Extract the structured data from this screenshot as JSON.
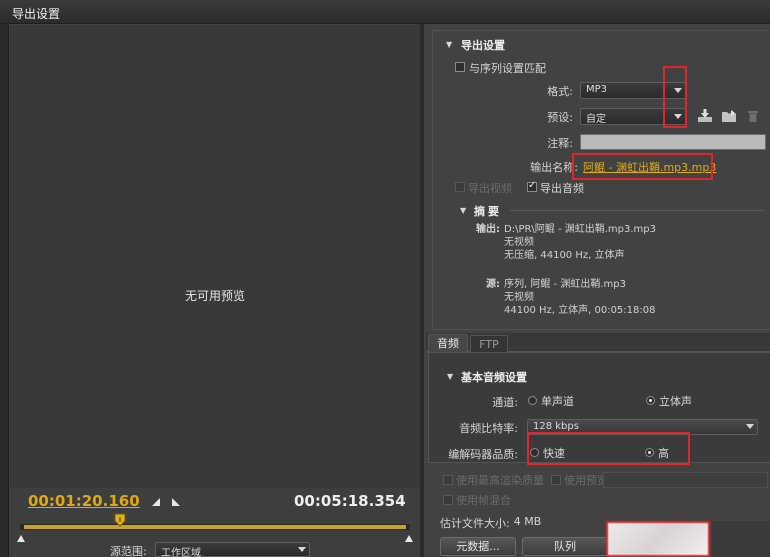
{
  "window": {
    "title": "导出设置"
  },
  "preview": {
    "no_preview_text": "无可用预览",
    "current_timecode": "00:01:20.160",
    "duration_timecode": "00:05:18.354",
    "source_range_label": "源范围:",
    "source_range_value": "工作区域"
  },
  "export_settings": {
    "section_title": "导出设置",
    "match_sequence_label": "与序列设置匹配",
    "match_sequence_checked": false,
    "format_label": "格式:",
    "format_value": "MP3",
    "preset_label": "预设:",
    "preset_value": "自定",
    "comments_label": "注释:",
    "output_name_label": "输出名称:",
    "output_name_value": "阿鲲 - 渊虹出鞘.mp3.mp3",
    "export_video_label": "导出视频",
    "export_video_checked": false,
    "export_audio_label": "导出音频",
    "export_audio_checked": true
  },
  "summary": {
    "section_title": "摘要",
    "output_label": "输出:",
    "output_lines": [
      "D:\\PR\\阿鲲 - 渊虹出鞘.mp3.mp3",
      "无视频",
      "无压缩, 44100 Hz, 立体声"
    ],
    "source_label": "源:",
    "source_lines": [
      "序列, 阿鲲 - 渊虹出鞘.mp3",
      "无视频",
      "44100 Hz, 立体声, 00:05:18:08"
    ]
  },
  "tabs": [
    {
      "label": "音频",
      "active": true
    },
    {
      "label": "FTP",
      "active": false
    }
  ],
  "audio": {
    "section_title": "基本音频设置",
    "channels_label": "通道:",
    "channel_options": [
      {
        "label": "单声道",
        "selected": false
      },
      {
        "label": "立体声",
        "selected": true
      }
    ],
    "bitrate_label": "音频比特率:",
    "bitrate_value": "128 kbps",
    "codec_quality_label": "编解码器品质:",
    "quality_options": [
      {
        "label": "快速",
        "selected": false
      },
      {
        "label": "高",
        "selected": true
      }
    ]
  },
  "render_options": {
    "max_render_quality_label": "使用最高渲染质量",
    "use_previews_label": "使用预览",
    "use_frame_blending_label": "使用帧混合"
  },
  "estimate": {
    "label": "估计文件大小:",
    "value": "4 MB"
  },
  "buttons": {
    "metadata": "元数据...",
    "queue": "队列"
  },
  "colors": {
    "accent_gold": "#e0a90f",
    "annotation_red": "#e0262a",
    "panel_bg": "#434343"
  },
  "icons": [
    "chevron-down-icon",
    "save-preset-icon",
    "import-preset-icon",
    "delete-preset-icon",
    "playhead-icon",
    "mark-in-icon",
    "mark-out-icon",
    "section-collapse-icon"
  ]
}
